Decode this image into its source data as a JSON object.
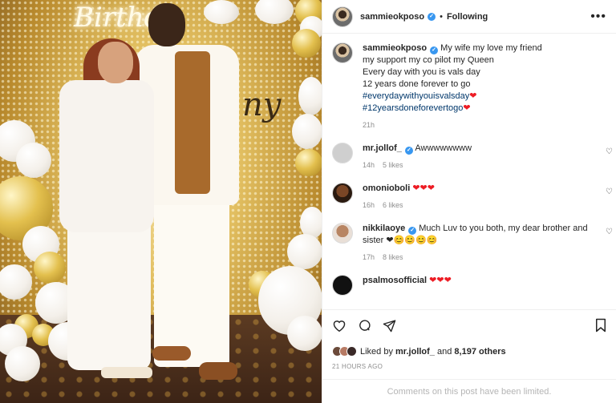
{
  "photo": {
    "neon_text": "Birthd",
    "sign_text": "ny"
  },
  "header": {
    "username": "sammieokposo",
    "verified_mark": "✓",
    "separator": "•",
    "follow_status": "Following",
    "more_icon": "more-horizontal-icon"
  },
  "caption": {
    "username": "sammieokposo",
    "lines": [
      "My wife my love my friend",
      "my support my co pilot my Queen",
      "Every day with you is vals day",
      "12 years done forever to go"
    ],
    "hashtags": [
      "#everydaywithyouisvalsday",
      "#12yearsdoneforevertogo"
    ],
    "heart": "❤",
    "time": "21h"
  },
  "comments": [
    {
      "username": "mr.jollof_",
      "verified": true,
      "text": "Awwwwwwww",
      "time": "14h",
      "likes": "5 likes",
      "avatar_color": "#c9c9c9"
    },
    {
      "username": "omonioboli",
      "verified": false,
      "text": "❤❤❤",
      "time": "16h",
      "likes": "6 likes",
      "avatar_color": "#6b3b1e"
    },
    {
      "username": "nikkilaoye",
      "verified": true,
      "text": "Much Luv to you both, my dear brother and sister ❤",
      "emoji": "😊😊😊😊",
      "time": "17h",
      "likes": "8 likes",
      "avatar_color": "#a87a5e"
    },
    {
      "username": "psalmosofficial",
      "verified": false,
      "text": "❤❤❤",
      "time": "",
      "likes": "",
      "avatar_color": "#111111"
    }
  ],
  "actions": {
    "like_icon": "heart-icon",
    "comment_icon": "comment-icon",
    "share_icon": "send-icon",
    "save_icon": "bookmark-icon"
  },
  "likes": {
    "prefix": "Liked by ",
    "user": "mr.jollof_",
    "suffix": " and ",
    "count": "8,197 others"
  },
  "posted": "21 HOURS AGO",
  "footer": "Comments on this post have been limited."
}
